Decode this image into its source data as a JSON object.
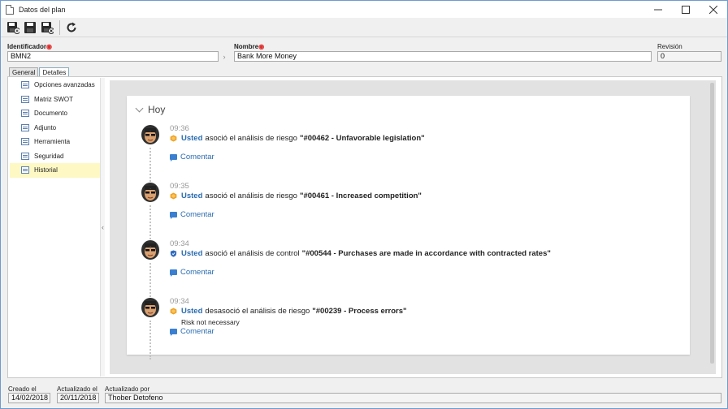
{
  "window": {
    "title": "Datos del plan",
    "controls": [
      "minimize-icon",
      "maximize-icon",
      "close-icon"
    ]
  },
  "toolbar": {
    "buttons": [
      "save-new-icon",
      "save-icon",
      "save-close-icon",
      "refresh-icon"
    ]
  },
  "fields": {
    "identificador": {
      "label": "Identificador",
      "value": "BMN2"
    },
    "nombre": {
      "label": "Nombre",
      "value": "Bank More Money"
    },
    "revision": {
      "label": "Revisión",
      "value": "0"
    }
  },
  "tabs": [
    "General",
    "Detalles"
  ],
  "active_tab": "Detalles",
  "sidebar": {
    "items": [
      {
        "label": "Opciones avanzadas"
      },
      {
        "label": "Matriz SWOT"
      },
      {
        "label": "Documento"
      },
      {
        "label": "Adjunto"
      },
      {
        "label": "Herramienta"
      },
      {
        "label": "Seguridad"
      },
      {
        "label": "Historial"
      }
    ],
    "active": "Historial"
  },
  "history": {
    "group_title": "Hoy",
    "entries": [
      {
        "time": "09:36",
        "user": "Usted",
        "verb": "asoció el análisis de riesgo",
        "object": "\"#00462 - Unfavorable legislation\"",
        "icon": "risk-hexagon-icon",
        "note": "",
        "comment": "Comentar"
      },
      {
        "time": "09:35",
        "user": "Usted",
        "verb": "asoció el análisis de riesgo",
        "object": "\"#00461 - Increased competition\"",
        "icon": "risk-hexagon-icon",
        "note": "",
        "comment": "Comentar"
      },
      {
        "time": "09:34",
        "user": "Usted",
        "verb": "asoció el análisis de control",
        "object": "\"#00544 - Purchases are made in accordance with contracted rates\"",
        "icon": "control-shield-icon",
        "note": "",
        "comment": "Comentar"
      },
      {
        "time": "09:34",
        "user": "Usted",
        "verb": "desasoció el análisis de riesgo",
        "object": "\"#00239 - Process errors\"",
        "icon": "risk-hexagon-icon",
        "note": "Risk not necessary",
        "comment": "Comentar"
      }
    ]
  },
  "footer": {
    "creado_label": "Creado el",
    "creado_value": "14/02/2018",
    "actualizado_label": "Actualizado el",
    "actualizado_value": "20/11/2018",
    "actualizado_por_label": "Actualizado por",
    "actualizado_por_value": "Thober Detofeno"
  },
  "colors": {
    "accent_blue": "#2b6cb0",
    "risk_orange": "#f0a020",
    "control_blue": "#2f6bc0",
    "active_nav": "#fdf8c4",
    "required_red": "#e03030"
  }
}
